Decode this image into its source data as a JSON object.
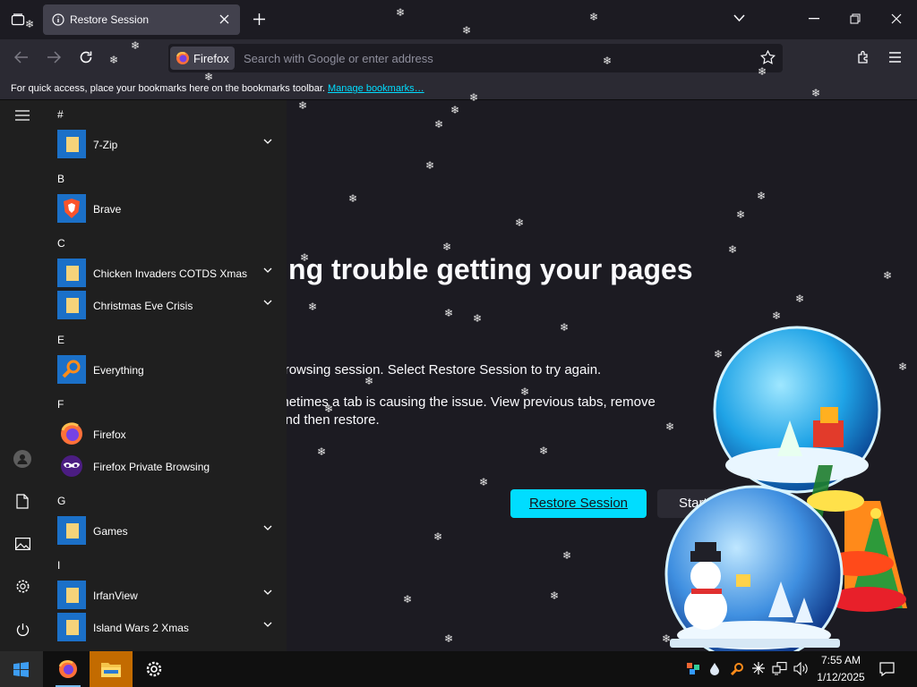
{
  "browser": {
    "tab_title": "Restore Session",
    "identity_label": "Firefox",
    "url_placeholder": "Search with Google or enter address",
    "bookmarks_hint": "For quick access, place your bookmarks here on the bookmarks toolbar.",
    "bookmarks_link": "Manage bookmarks…"
  },
  "page": {
    "title": "having trouble getting your pages",
    "paragraph1": "g your last browsing session. Select Restore Session to try again.",
    "paragraph2_line1": "ession? Sometimes a tab is causing the issue. View previous tabs, remove",
    "paragraph2_line2": "to recover, and then restore.",
    "restore_button": "Restore Session",
    "new_session_button": "Start N"
  },
  "start_menu": {
    "groups": [
      {
        "letter": "#",
        "items": [
          {
            "label": "7-Zip",
            "icon": "folder-icon",
            "expandable": true
          }
        ]
      },
      {
        "letter": "B",
        "items": [
          {
            "label": "Brave",
            "icon": "brave-icon",
            "expandable": false
          }
        ]
      },
      {
        "letter": "C",
        "items": [
          {
            "label": "Chicken Invaders COTDS Xmas",
            "icon": "folder-icon",
            "expandable": true
          },
          {
            "label": "Christmas Eve Crisis",
            "icon": "folder-icon",
            "expandable": true
          }
        ]
      },
      {
        "letter": "E",
        "items": [
          {
            "label": "Everything",
            "icon": "everything-search-icon",
            "expandable": false
          }
        ]
      },
      {
        "letter": "F",
        "items": [
          {
            "label": "Firefox",
            "icon": "firefox-icon",
            "expandable": false
          },
          {
            "label": "Firefox Private Browsing",
            "icon": "firefox-private-icon",
            "expandable": false
          }
        ]
      },
      {
        "letter": "G",
        "items": [
          {
            "label": "Games",
            "icon": "folder-icon",
            "expandable": true
          }
        ]
      },
      {
        "letter": "I",
        "items": [
          {
            "label": "IrfanView",
            "icon": "folder-icon",
            "expandable": true
          },
          {
            "label": "Island Wars 2 Xmas",
            "icon": "folder-icon",
            "expandable": true
          }
        ]
      }
    ]
  },
  "taskbar": {
    "time": "7:55 AM",
    "date": "1/12/2025"
  },
  "colors": {
    "accent": "#00ddff",
    "chrome_bg": "#1c1b22",
    "toolbar_bg": "#2b2a33",
    "start_bg": "#1f1f1f"
  }
}
